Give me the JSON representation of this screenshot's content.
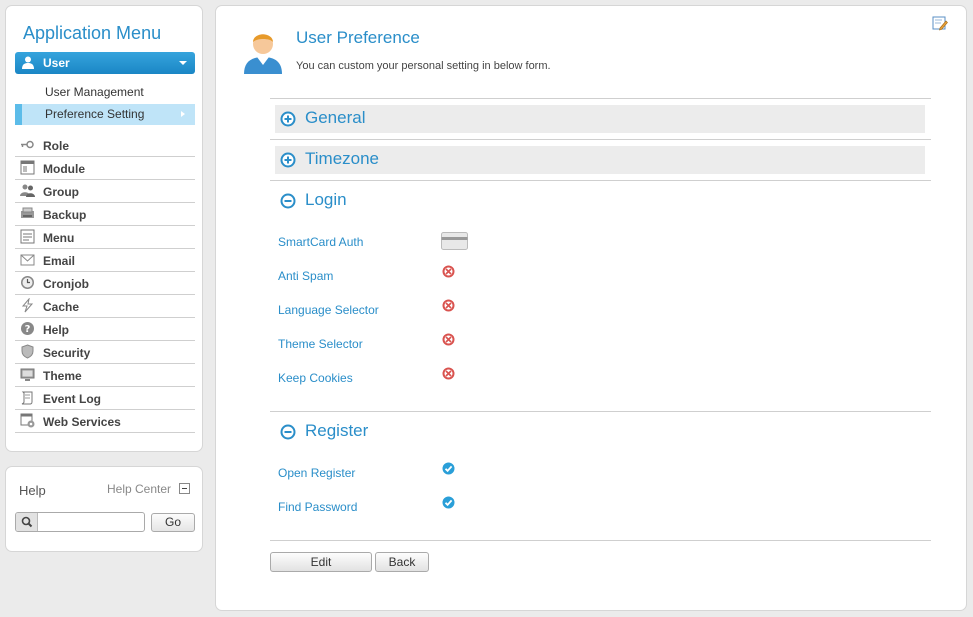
{
  "sidebar": {
    "title": "Application Menu",
    "user_label": "User",
    "sub_items": [
      {
        "label": "User Management"
      },
      {
        "label": "Preference Setting"
      }
    ],
    "menu": [
      {
        "label": "Role",
        "icon": "key-icon"
      },
      {
        "label": "Module",
        "icon": "window-icon"
      },
      {
        "label": "Group",
        "icon": "group-icon"
      },
      {
        "label": "Backup",
        "icon": "backup-icon"
      },
      {
        "label": "Menu",
        "icon": "menu-icon"
      },
      {
        "label": "Email",
        "icon": "email-icon"
      },
      {
        "label": "Cronjob",
        "icon": "clock-icon"
      },
      {
        "label": "Cache",
        "icon": "lightning-icon"
      },
      {
        "label": "Help",
        "icon": "help-icon"
      },
      {
        "label": "Security",
        "icon": "shield-icon"
      },
      {
        "label": "Theme",
        "icon": "monitor-icon"
      },
      {
        "label": "Event Log",
        "icon": "scroll-icon"
      },
      {
        "label": "Web Services",
        "icon": "web-services-icon"
      }
    ]
  },
  "help": {
    "title": "Help",
    "center_label": "Help Center",
    "search_value": "",
    "go_label": "Go"
  },
  "main": {
    "title": "User Preference",
    "subtitle": "You can custom your personal setting in below form.",
    "sections": {
      "general": "General",
      "timezone": "Timezone",
      "login": "Login",
      "register": "Register"
    },
    "login_fields": [
      {
        "label": "SmartCard Auth",
        "status": "card"
      },
      {
        "label": "Anti Spam",
        "status": "disabled"
      },
      {
        "label": "Language Selector",
        "status": "disabled"
      },
      {
        "label": "Theme Selector",
        "status": "disabled"
      },
      {
        "label": "Keep Cookies",
        "status": "disabled"
      }
    ],
    "register_fields": [
      {
        "label": "Open Register",
        "status": "enabled"
      },
      {
        "label": "Find Password",
        "status": "enabled"
      }
    ],
    "buttons": {
      "edit": "Edit",
      "back": "Back"
    }
  },
  "colors": {
    "accent": "#2a8ec9",
    "active_bg": "#bfe4f8",
    "disabled": "#d9534f",
    "enabled": "#2a9fd8"
  }
}
